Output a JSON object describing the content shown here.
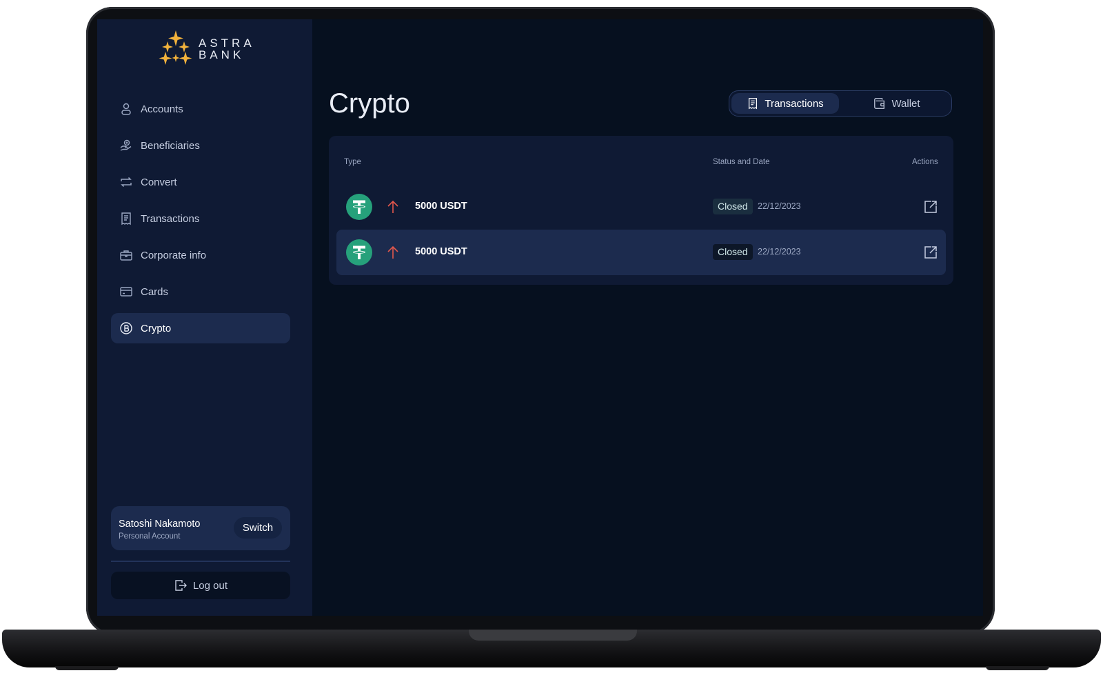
{
  "brand": {
    "line1": "ASTRA",
    "line2": "BANK",
    "accent_color": "#f2b23c"
  },
  "sidebar": {
    "items": [
      {
        "label": "Accounts",
        "icon": "user-icon"
      },
      {
        "label": "Beneficiaries",
        "icon": "hand-coins-icon"
      },
      {
        "label": "Convert",
        "icon": "convert-arrows-icon"
      },
      {
        "label": "Transactions",
        "icon": "receipt-icon"
      },
      {
        "label": "Corporate info",
        "icon": "briefcase-icon"
      },
      {
        "label": "Cards",
        "icon": "credit-card-icon"
      },
      {
        "label": "Crypto",
        "icon": "bitcoin-icon",
        "active": true
      }
    ],
    "account": {
      "name": "Satoshi Nakamoto",
      "type": "Personal Account",
      "switch_label": "Switch"
    },
    "logout_label": "Log out"
  },
  "main": {
    "title": "Crypto",
    "tabs": [
      {
        "label": "Transactions",
        "icon": "receipt-icon",
        "active": true
      },
      {
        "label": "Wallet",
        "icon": "wallet-icon",
        "active": false
      }
    ],
    "table": {
      "headers": {
        "type": "Type",
        "status_date": "Status and Date",
        "actions": "Actions"
      },
      "rows": [
        {
          "coin_icon": "tether-icon",
          "direction_icon": "arrow-up-icon",
          "amount": "5000 USDT",
          "status": "Closed",
          "date": "22/12/2023",
          "action_icon": "external-link-icon"
        },
        {
          "coin_icon": "tether-icon",
          "direction_icon": "arrow-up-icon",
          "amount": "5000 USDT",
          "status": "Closed",
          "date": "22/12/2023",
          "action_icon": "external-link-icon"
        }
      ]
    }
  },
  "colors": {
    "screen_bg": "#06101f",
    "sidebar_bg": "#0f1a34",
    "active_bg": "#1c2b4e",
    "tether_green": "#26a17b",
    "arrow_red": "#e2574c"
  }
}
